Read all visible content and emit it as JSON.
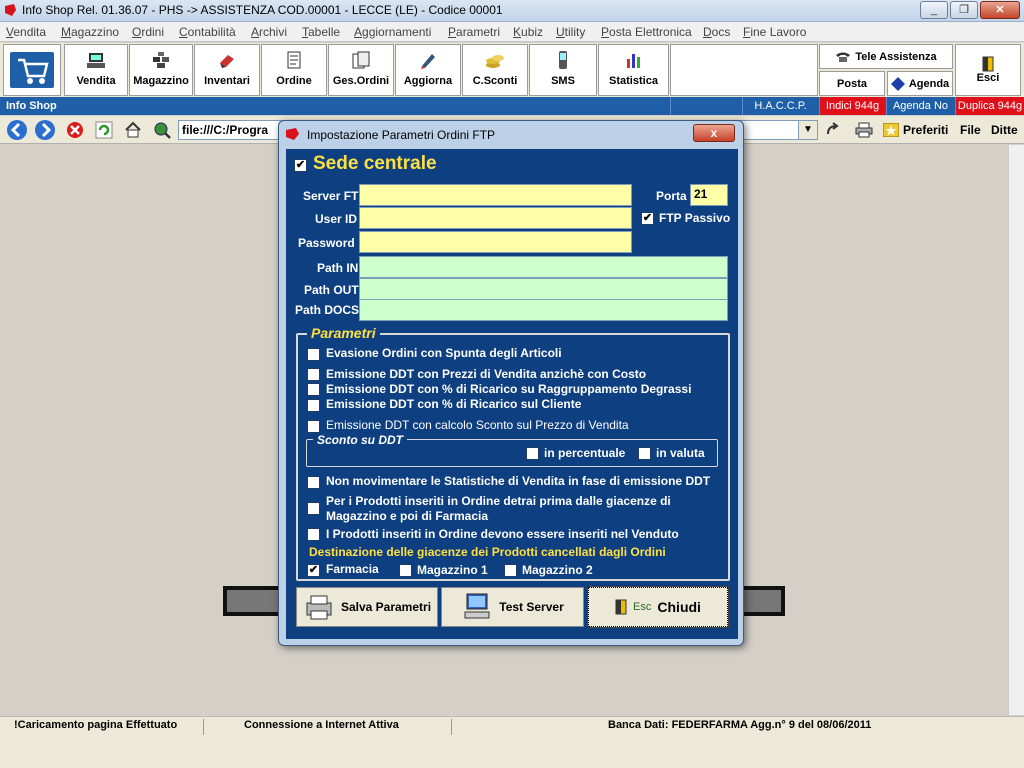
{
  "window": {
    "title": "Info Shop Rel. 01.36.07 - PHS -> ASSISTENZA COD.00001 - LECCE (LE) - Codice 00001"
  },
  "menu": [
    "Vendita",
    "Magazzino",
    "Ordini",
    "Contabilità",
    "Archivi",
    "Tabelle",
    "Aggiornamenti",
    "Parametri",
    "Kubiz",
    "Utility",
    "Posta Elettronica",
    "Docs",
    "Fine Lavoro"
  ],
  "toolbar": {
    "buttons": [
      "Vendita",
      "Magazzino",
      "Inventari",
      "Ordine",
      "Ges.Ordini",
      "Aggiorna",
      "C.Sconti",
      "SMS",
      "Statistica"
    ],
    "tele_assistenza": "Tele Assistenza",
    "posta": "Posta",
    "agenda": "Agenda",
    "esci": "Esci"
  },
  "infostrip": {
    "left": "Info Shop",
    "haccp": "H.A.C.C.P.",
    "indici": "Indici 944g",
    "agenda_no": "Agenda No",
    "duplica": "Duplica 944g"
  },
  "nav": {
    "address": "file:///C:/Progra",
    "preferiti": "Preferiti",
    "file": "File",
    "ditte": "Ditte"
  },
  "status": {
    "s1": "!Caricamento pagina Effettuato",
    "s2": "Connessione a Internet Attiva",
    "s3": "Banca Dati: FEDERFARMA Agg.n° 9 del 08/06/2011"
  },
  "dialog": {
    "title": "Impostazione Parametri Ordini FTP",
    "close": "x",
    "sede": {
      "label": "Sede centrale",
      "checked": true
    },
    "fields": {
      "server_label": "Server FTP",
      "user_label": "User ID",
      "password_label": "Password",
      "path_in_label": "Path IN",
      "path_out_label": "Path OUT",
      "path_docs_label": "Path DOCS",
      "porta_label": "Porta",
      "porta_value": "21",
      "ftp_passivo_label": "FTP Passivo",
      "ftp_passivo_checked": true
    },
    "parametri": {
      "title": "Parametri",
      "items": [
        "Evasione Ordini con Spunta degli Articoli",
        "Emissione DDT con Prezzi di Vendita anzichè con Costo",
        "Emissione DDT con % di Ricarico su Raggruppamento Degrassi",
        "Emissione DDT con % di Ricarico sul Cliente",
        "Emissione DDT con calcolo Sconto sul Prezzo di Vendita"
      ],
      "sconto_title": "Sconto su DDT",
      "in_percentuale": "in percentuale",
      "in_valuta": "in valuta",
      "items2": [
        "Non movimentare  le Statistiche di Vendita in fase di emissione DDT",
        "Per i Prodotti inseriti in Ordine detrai prima dalle giacenze di",
        "Magazzino e poi di Farmacia",
        "I Prodotti inseriti in Ordine devono essere inseriti nel Venduto"
      ],
      "destinazione": "Destinazione delle giacenze dei Prodotti cancellati dagli Ordini",
      "farmacia": "Farmacia",
      "farmacia_checked": true,
      "magazzino1": "Magazzino 1",
      "magazzino2": "Magazzino 2"
    },
    "buttons": {
      "salva": "Salva Parametri",
      "test": "Test Server",
      "esc": "Esc",
      "chiudi": "Chiudi"
    }
  }
}
